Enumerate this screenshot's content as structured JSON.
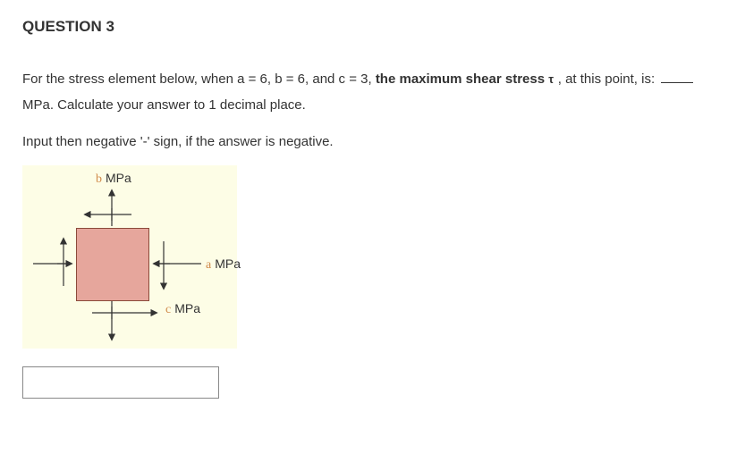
{
  "title": "QUESTION 3",
  "text": {
    "part1": "For the stress element below, when a = 6, b = 6, and c = 3, ",
    "bold": "the maximum shear stress ",
    "tau": "τ",
    "part2": " , at this point, is: ",
    "part3": " MPa. Calculate your answer to 1 decimal place.",
    "instr": "Input then negative '-' sign, if the answer is negative."
  },
  "diagram": {
    "a_label": "a",
    "b_label": "b",
    "c_label": "c",
    "unit": "MPa"
  },
  "answer_placeholder": ""
}
